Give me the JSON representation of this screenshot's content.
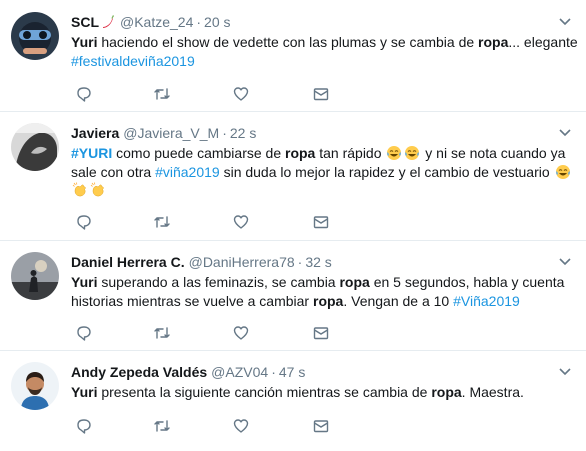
{
  "tweets": [
    {
      "name": "SCL",
      "name_emoji": "chili-pepper",
      "handle": "@Katze_24",
      "dot": "·",
      "time": "20 s",
      "text": [
        {
          "t": "Yuri",
          "b": true
        },
        {
          "t": " haciendo el show de vedette con las plumas y se cambia de "
        },
        {
          "t": "ropa",
          "b": true
        },
        {
          "t": "... elegante "
        },
        {
          "t": "#festivaldeviña2019",
          "tag": true
        }
      ]
    },
    {
      "name": "Javiera",
      "handle": "@Javiera_V_M",
      "dot": "·",
      "time": "22 s",
      "text": [
        {
          "t": "#YURI",
          "tag": true,
          "b": true
        },
        {
          "t": " como puede cambiarse  de "
        },
        {
          "t": "ropa",
          "b": true
        },
        {
          "t": "  tan rápido  "
        },
        {
          "emoji": "tears-of-joy"
        },
        {
          "emoji": "tears-of-joy"
        },
        {
          "t": "  y ni se nota  cuando ya sale con otra "
        },
        {
          "t": "#viña2019",
          "tag": true
        },
        {
          "t": "  sin duda lo mejor la rapidez  y el cambio de vestuario "
        },
        {
          "emoji": "tears-of-joy"
        },
        {
          "emoji": "clapping-hands"
        },
        {
          "emoji": "clapping-hands"
        }
      ]
    },
    {
      "name": "Daniel Herrera C.",
      "handle": "@DaniHerrera78",
      "dot": "·",
      "time": "32 s",
      "text": [
        {
          "t": "Yuri",
          "b": true
        },
        {
          "t": " superando a las feminazis, se cambia "
        },
        {
          "t": "ropa",
          "b": true
        },
        {
          "t": " en 5 segundos, habla y cuenta historias mientras se vuelve a cambiar "
        },
        {
          "t": "ropa",
          "b": true
        },
        {
          "t": ". Vengan de a 10 "
        },
        {
          "t": "#Viña2019",
          "tag": true
        }
      ]
    },
    {
      "name": "Andy Zepeda Valdés",
      "handle": "@AZV04",
      "dot": "·",
      "time": "47 s",
      "text": [
        {
          "t": "Yuri",
          "b": true
        },
        {
          "t": " presenta la siguiente canción mientras se cambia de "
        },
        {
          "t": "ropa",
          "b": true
        },
        {
          "t": ". Maestra."
        }
      ]
    }
  ],
  "icons": {
    "reply": "reply-icon",
    "retweet": "retweet-icon",
    "like": "heart-icon",
    "dm": "envelope-icon",
    "more": "chevron-down-icon"
  },
  "colors": {
    "text": "#14171a",
    "secondary": "#657786",
    "link": "#1b95e0",
    "divider": "#e6ecf0"
  }
}
